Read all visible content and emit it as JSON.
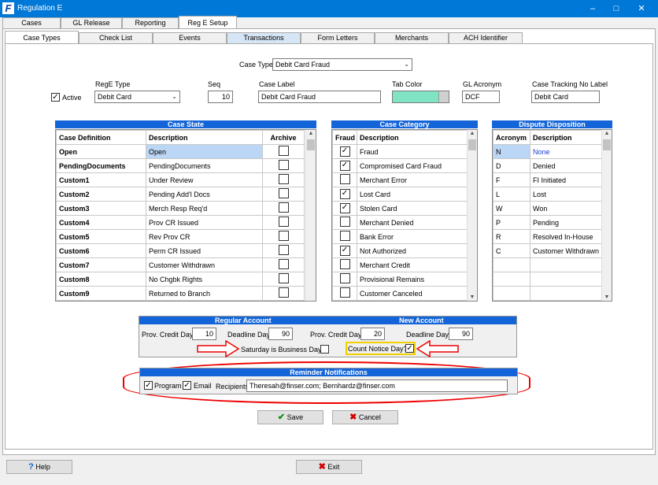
{
  "window": {
    "title": "Regulation E",
    "app_icon_glyph": "F"
  },
  "top_tabs": [
    "Cases",
    "GL Release",
    "Reporting",
    "Reg E Setup"
  ],
  "sub_tabs": [
    "Case Types",
    "Check List",
    "Events",
    "Transactions",
    "Form Letters",
    "Merchants",
    "ACH Identifier"
  ],
  "case_type": {
    "label": "Case Type",
    "value": "Debit Card Fraud"
  },
  "fields": {
    "active_label": "Active",
    "rege_type_label": "RegE Type",
    "rege_type_value": "Debit Card",
    "seq_label": "Seq",
    "seq_value": "10",
    "case_label_label": "Case Label",
    "case_label_value": "Debit Card Fraud",
    "tab_color_label": "Tab Color",
    "gl_acronym_label": "GL Acronym",
    "gl_acronym_value": "DCF",
    "tracking_label": "Case Tracking No Label",
    "tracking_value": "Debit Card"
  },
  "case_state": {
    "title": "Case State",
    "headers": [
      "Case Definition",
      "Description",
      "Archive"
    ],
    "rows": [
      {
        "def": "Open",
        "desc": "Open"
      },
      {
        "def": "PendingDocuments",
        "desc": "PendingDocuments"
      },
      {
        "def": "Custom1",
        "desc": "Under Review"
      },
      {
        "def": "Custom2",
        "desc": "Pending Add'l Docs"
      },
      {
        "def": "Custom3",
        "desc": "Merch Resp Req'd"
      },
      {
        "def": "Custom4",
        "desc": "Prov CR Issued"
      },
      {
        "def": "Custom5",
        "desc": "Rev Prov CR"
      },
      {
        "def": "Custom6",
        "desc": "Perm CR Issued"
      },
      {
        "def": "Custom7",
        "desc": "Customer Withdrawn"
      },
      {
        "def": "Custom8",
        "desc": "No Chgbk Rights"
      },
      {
        "def": "Custom9",
        "desc": "Returned to Branch"
      }
    ]
  },
  "case_category": {
    "title": "Case Category",
    "headers": [
      "Fraud",
      "Description"
    ],
    "rows": [
      {
        "fraud": true,
        "desc": "Fraud"
      },
      {
        "fraud": true,
        "desc": "Compromised Card Fraud"
      },
      {
        "fraud": false,
        "desc": "Merchant Error"
      },
      {
        "fraud": true,
        "desc": "Lost Card"
      },
      {
        "fraud": true,
        "desc": "Stolen Card"
      },
      {
        "fraud": false,
        "desc": "Merchant Denied"
      },
      {
        "fraud": false,
        "desc": "Bank Error"
      },
      {
        "fraud": true,
        "desc": "Not Authorized"
      },
      {
        "fraud": false,
        "desc": "Merchant Credit"
      },
      {
        "fraud": false,
        "desc": "Provisional Remains"
      },
      {
        "fraud": false,
        "desc": "Customer Canceled"
      }
    ]
  },
  "dispute_disposition": {
    "title": "Dispute Disposition",
    "headers": [
      "Acronym",
      "Description"
    ],
    "rows": [
      {
        "acr": "N",
        "desc": "None"
      },
      {
        "acr": "D",
        "desc": "Denied"
      },
      {
        "acr": "F",
        "desc": "FI Initiated"
      },
      {
        "acr": "L",
        "desc": "Lost"
      },
      {
        "acr": "W",
        "desc": "Won"
      },
      {
        "acr": "P",
        "desc": "Pending"
      },
      {
        "acr": "R",
        "desc": "Resolved In-House"
      },
      {
        "acr": "C",
        "desc": "Customer Withdrawn"
      },
      {
        "acr": "",
        "desc": ""
      },
      {
        "acr": "",
        "desc": ""
      },
      {
        "acr": "",
        "desc": ""
      }
    ]
  },
  "accounts": {
    "regular_title": "Regular Account",
    "new_title": "New Account",
    "reg_prov_label": "Prov. Credit Days",
    "reg_prov_value": "10",
    "reg_deadline_label": "Deadline Days",
    "reg_deadline_value": "90",
    "new_prov_label": "Prov. Credit Days",
    "new_prov_value": "20",
    "new_deadline_label": "Deadline Days",
    "new_deadline_value": "90",
    "saturday_label": "Saturday is Business Day?",
    "count_notice_label": "Count Notice Day?"
  },
  "reminders": {
    "title": "Reminder Notifications",
    "program_label": "Program",
    "email_label": "Email",
    "recipients_label": "Recipients",
    "recipients_value": "Theresah@finser.com; Bernhardz@finser.com"
  },
  "buttons": {
    "save": "Save",
    "cancel": "Cancel",
    "help": "Help",
    "exit": "Exit"
  },
  "colors": {
    "accent": "#1364d8",
    "highlight_red": "#e00000",
    "tab_color": "#7fe3c4",
    "title_bar": "#0078d7"
  }
}
